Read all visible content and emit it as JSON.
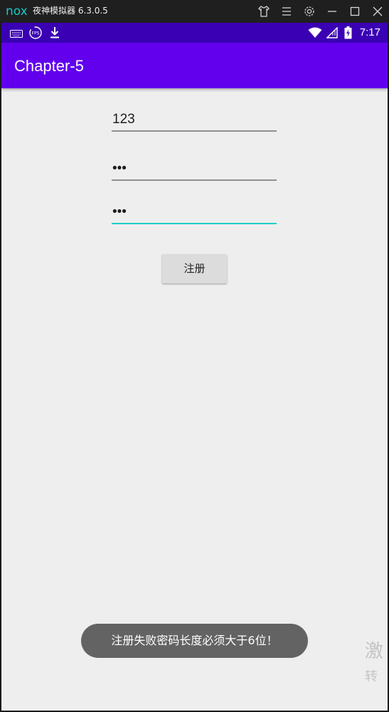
{
  "emulator": {
    "logo": "nox",
    "title": "夜神模拟器 6.3.0.5",
    "controls": [
      "shirt-icon",
      "menu-icon",
      "gear-icon",
      "minimize-icon",
      "maximize-icon",
      "close-icon"
    ]
  },
  "status_bar": {
    "left_icons": [
      "keyboard-icon",
      "fps-icon",
      "download-icon"
    ],
    "right_icons": [
      "wifi-icon",
      "signal-icon",
      "battery-icon"
    ],
    "time": "7:17",
    "color": "#3a00b4"
  },
  "app_bar": {
    "title": "Chapter-5",
    "color": "#6200ee"
  },
  "form": {
    "username_value": "123",
    "password_value": "•••",
    "confirm_password_value": "•••",
    "register_label": "注册",
    "focus_color": "#1ed0c8"
  },
  "toast": {
    "message": "注册失败密码长度必须大于6位！"
  },
  "watermark": {
    "line1": "激",
    "line2": "转"
  }
}
